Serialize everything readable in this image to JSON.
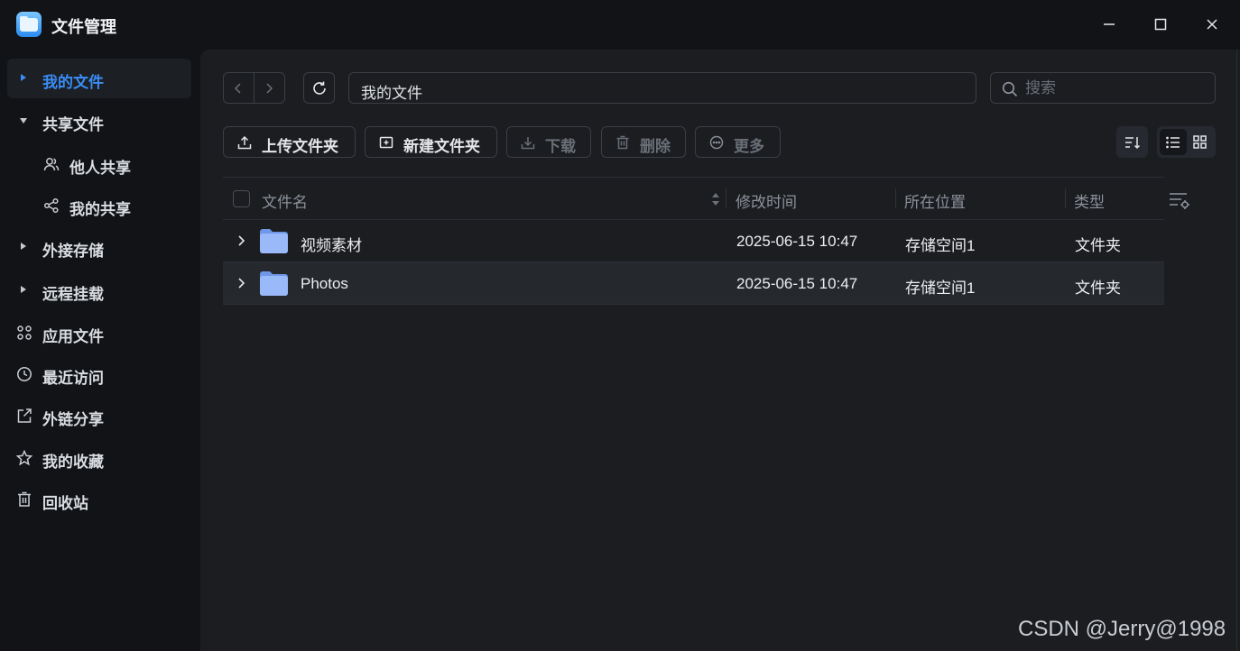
{
  "app": {
    "title": "文件管理",
    "icon": "file-manager-app-icon"
  },
  "window_controls": {
    "minimize": "minimize-icon",
    "maximize": "maximize-icon",
    "close": "close-icon"
  },
  "sidebar": {
    "items": [
      {
        "label": "我的文件",
        "icon": "caret-right",
        "active": true
      },
      {
        "label": "共享文件",
        "icon": "caret-down",
        "expanded": true
      },
      {
        "label": "他人共享",
        "icon": "users-icon",
        "sub": true
      },
      {
        "label": "我的共享",
        "icon": "share-icon",
        "sub": true
      },
      {
        "label": "外接存储",
        "icon": "caret-right"
      },
      {
        "label": "远程挂载",
        "icon": "caret-right"
      },
      {
        "label": "应用文件",
        "icon": "apps-icon"
      },
      {
        "label": "最近访问",
        "icon": "clock-icon"
      },
      {
        "label": "外链分享",
        "icon": "external-link-icon"
      },
      {
        "label": "我的收藏",
        "icon": "star-icon"
      },
      {
        "label": "回收站",
        "icon": "trash-icon"
      }
    ]
  },
  "toolbar": {
    "path": "我的文件",
    "search_placeholder": "搜索",
    "upload_label": "上传文件夹",
    "new_folder_label": "新建文件夹",
    "download_label": "下载",
    "delete_label": "删除",
    "more_label": "更多"
  },
  "table": {
    "headers": {
      "name": "文件名",
      "modified": "修改时间",
      "location": "所在位置",
      "type": "类型"
    },
    "rows": [
      {
        "name": "视频素材",
        "modified": "2025-06-15 10:47",
        "location": "存储空间1",
        "type": "文件夹"
      },
      {
        "name": "Photos",
        "modified": "2025-06-15 10:47",
        "location": "存储空间1",
        "type": "文件夹"
      }
    ]
  },
  "colors": {
    "accent": "#3b8cf3",
    "folder": "#8fb3f8",
    "background": "#111316",
    "panel": "#1b1d21"
  },
  "watermark": "CSDN @Jerry@1998"
}
